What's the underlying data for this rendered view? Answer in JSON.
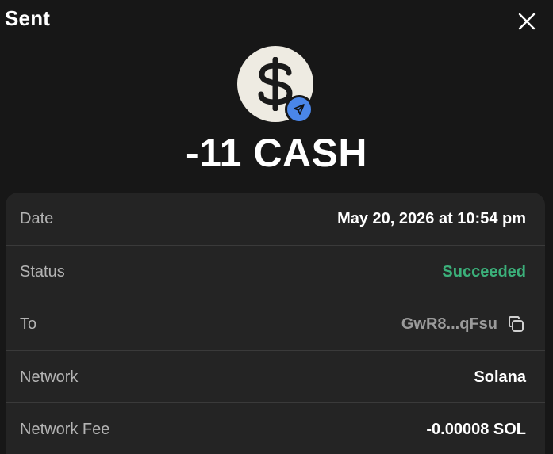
{
  "header": {
    "title": "Sent",
    "close_icon": "close-icon"
  },
  "token": {
    "icon": "dollar-sign-icon",
    "badge_icon": "send-icon",
    "badge_color": "#4a86e8"
  },
  "amount": "-11 CASH",
  "details": {
    "date": {
      "label": "Date",
      "value": "May 20, 2026 at 10:54 pm"
    },
    "status": {
      "label": "Status",
      "value": "Succeeded",
      "color": "#3bb07a"
    },
    "to": {
      "label": "To",
      "value": "GwR8...qFsu",
      "copy_icon": "copy-icon"
    },
    "network": {
      "label": "Network",
      "value": "Solana"
    },
    "network_fee": {
      "label": "Network Fee",
      "value": "-0.00008 SOL"
    }
  }
}
